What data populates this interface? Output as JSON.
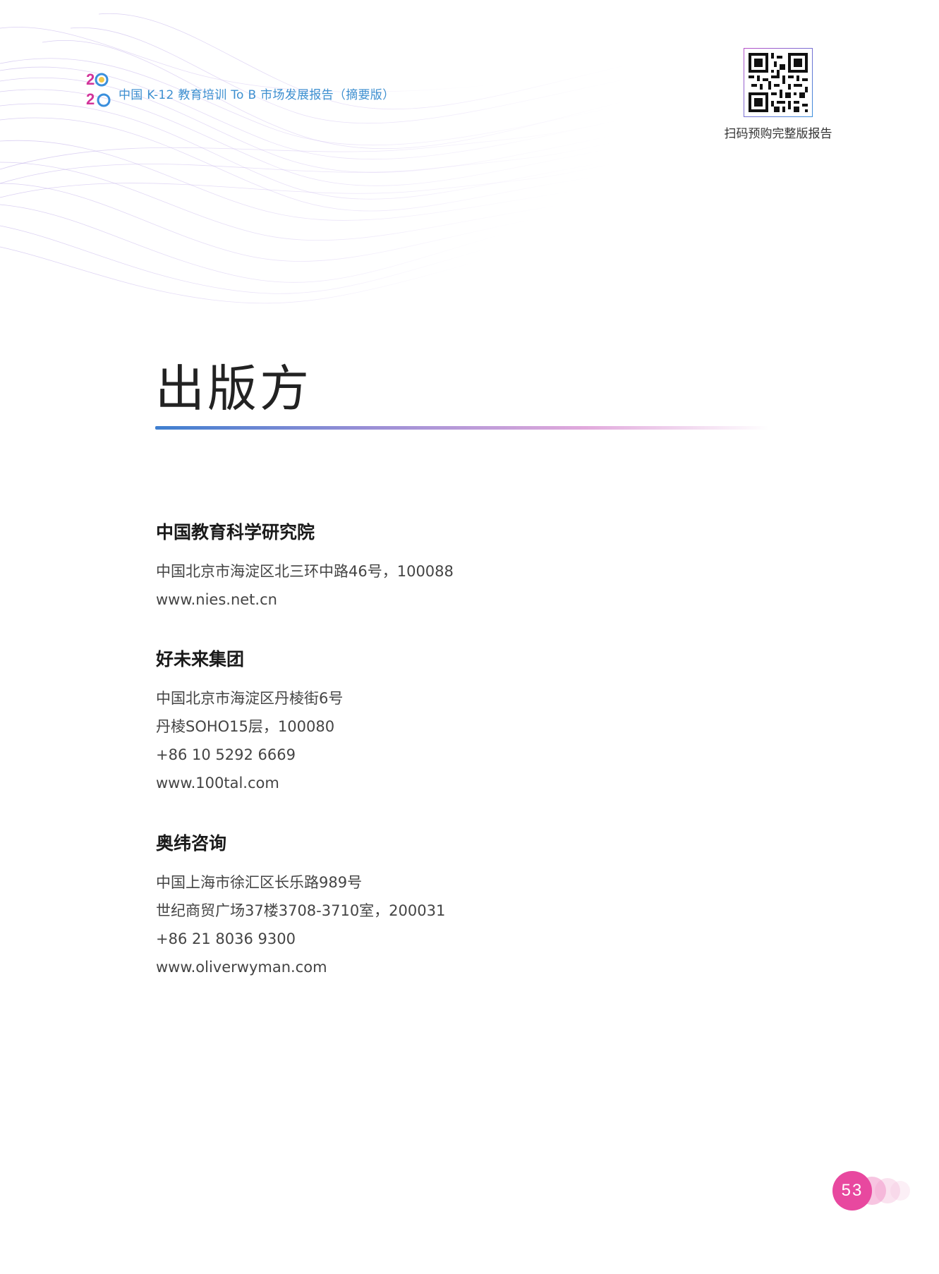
{
  "header": {
    "report_title": "中国 K-12 教育培训 To B 市场发展报告（摘要版）",
    "logo_icon": "2020-logo-icon",
    "qr_icon": "qr-code-icon",
    "qr_caption": "扫码预购完整版报告"
  },
  "page_title": "出版方",
  "publishers": [
    {
      "name": "中国教育科学研究院",
      "lines": [
        "中国北京市海淀区北三环中路46号，100088",
        "www.nies.net.cn"
      ]
    },
    {
      "name": "好未来集团",
      "lines": [
        "中国北京市海淀区丹棱街6号",
        "丹棱SOHO15层，100080",
        "+86 10 5292 6669",
        "www.100tal.com"
      ]
    },
    {
      "name": "奥纬咨询",
      "lines": [
        "中国上海市徐汇区长乐路989号",
        "世纪商贸广场37楼3708-3710室，200031",
        "+86 21 8036 9300",
        "www.oliverwyman.com"
      ]
    }
  ],
  "page_number": "53",
  "colors": {
    "accent_blue": "#3d8fd0",
    "accent_pink": "#e8489f",
    "accent_purple": "#b9a6e6"
  }
}
